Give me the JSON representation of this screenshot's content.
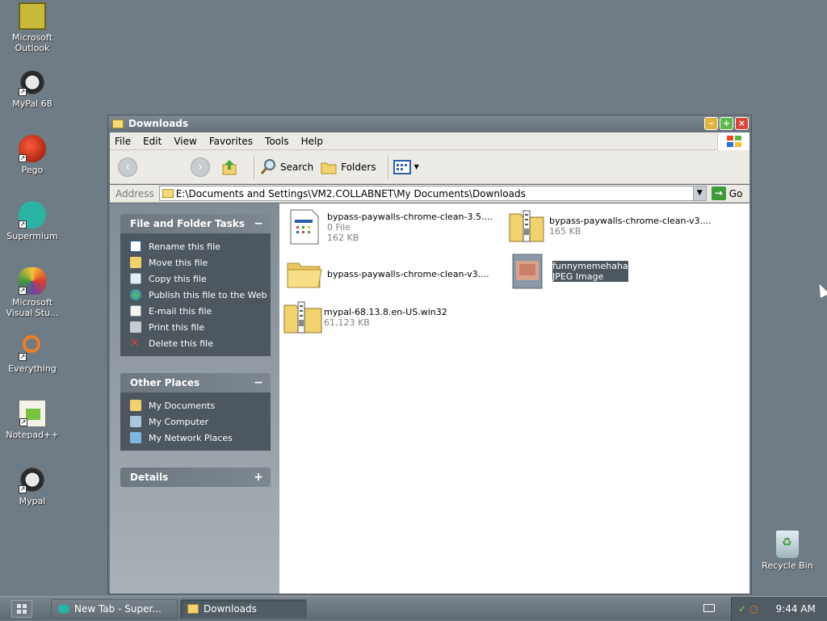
{
  "desktop": {
    "icons": [
      {
        "label": "Microsoft\nOutlook",
        "l1": "Microsoft",
        "l2": "Outlook"
      },
      {
        "l1": "MyPal 68",
        "l2": ""
      },
      {
        "l1": "Pego",
        "l2": ""
      },
      {
        "l1": "Supermium",
        "l2": ""
      },
      {
        "l1": "Microsoft",
        "l2": "Visual Stu..."
      },
      {
        "l1": "Everything",
        "l2": ""
      },
      {
        "l1": "Notepad++",
        "l2": ""
      },
      {
        "l1": "Mypal",
        "l2": ""
      }
    ],
    "recycle_bin": "Recycle Bin"
  },
  "window": {
    "title": "Downloads",
    "menu": [
      "File",
      "Edit",
      "View",
      "Favorites",
      "Tools",
      "Help"
    ],
    "toolbar": {
      "search": "Search",
      "folders": "Folders"
    },
    "address": {
      "label": "Address",
      "value": "E:\\Documents and Settings\\VM2.COLLABNET\\My Documents\\Downloads",
      "go": "Go"
    }
  },
  "taskpane": {
    "file_tasks": {
      "title": "File and Folder Tasks",
      "toggle": "−",
      "items": [
        "Rename this file",
        "Move this file",
        "Copy this file",
        "Publish this file to the Web",
        "E-mail this file",
        "Print this file",
        "Delete this file"
      ]
    },
    "other_places": {
      "title": "Other Places",
      "toggle": "−",
      "items": [
        "My Documents",
        "My Computer",
        "My Network Places"
      ]
    },
    "details": {
      "title": "Details",
      "toggle": "+"
    }
  },
  "files": [
    {
      "name": "bypass-paywalls-chrome-clean-3.5....",
      "line2": "0 File",
      "line3": "162 KB"
    },
    {
      "name": "bypass-paywalls-chrome-clean-v3....",
      "line2": "165 KB",
      "line3": ""
    },
    {
      "name": "bypass-paywalls-chrome-clean-v3....",
      "line2": "",
      "line3": ""
    },
    {
      "name": "funnymemehaha",
      "line2": "JPEG Image",
      "line3": ""
    },
    {
      "name": "mypal-68.13.8.en-US.win32",
      "line2": "61,123 KB",
      "line3": ""
    }
  ],
  "taskbar": {
    "tasks": [
      "New Tab - Super...",
      "Downloads"
    ],
    "clock": "9:44 AM"
  },
  "colors": {
    "desktop": "#6f7b85",
    "selection": "#4d575f"
  }
}
